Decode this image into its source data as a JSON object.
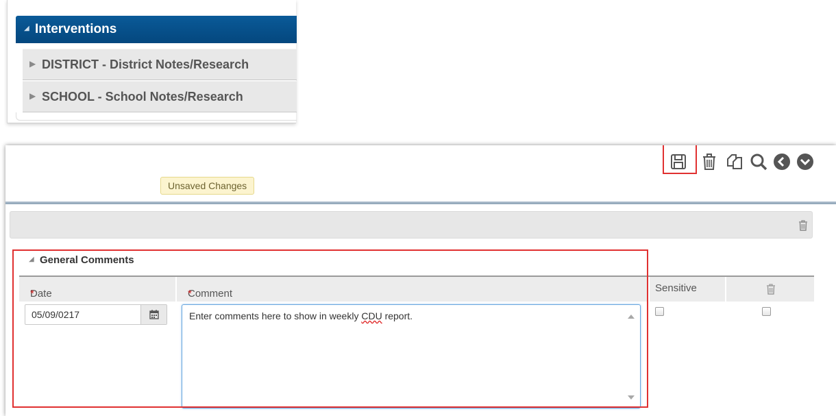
{
  "interventions": {
    "title": "Interventions",
    "items": [
      {
        "label": "DISTRICT - District Notes/Research"
      },
      {
        "label": "SCHOOL - School Notes/Research"
      }
    ]
  },
  "toolbar": {
    "icons": [
      "save-icon",
      "trash-icon",
      "copy-icon",
      "search-icon",
      "back-icon",
      "more-icon"
    ],
    "highlight_color": "#e03030"
  },
  "status": {
    "unsaved_label": "Unsaved Changes",
    "badge_color": "#fcf4cf"
  },
  "general_comments": {
    "title": "General Comments",
    "columns": {
      "date": "Date",
      "comment": "Comment",
      "sensitive": "Sensitive",
      "required_marker": "*"
    },
    "row": {
      "date_value": "05/09/0217",
      "comment_prefix": "Enter comments here to show in weekly ",
      "comment_misspelled": "CDU",
      "comment_suffix": " report.",
      "sensitive_checked": false,
      "delete_checked": false
    }
  },
  "colors": {
    "header_blue": "#04477e",
    "focus_blue": "#66a6df",
    "required_red": "#d02020"
  }
}
